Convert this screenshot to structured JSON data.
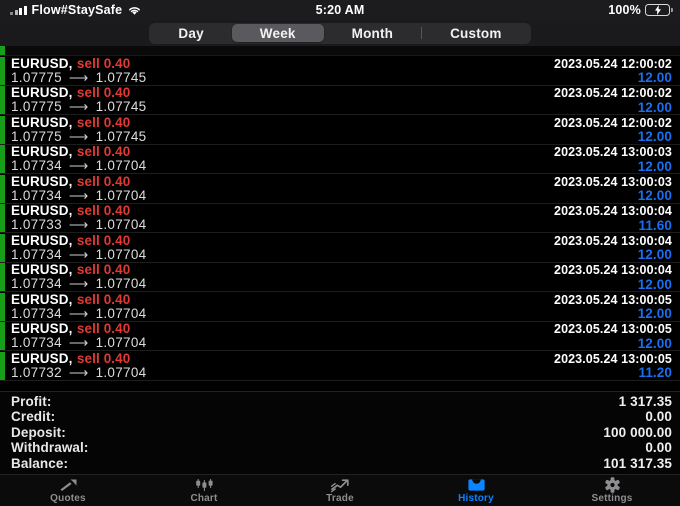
{
  "statusbar": {
    "carrier": "Flow#StaySafe",
    "time": "5:20 AM",
    "battery_percent": "100%",
    "signal_icon": "cellular-signal-icon",
    "wifi_icon": "wifi-icon",
    "battery_icon": "battery-charging-icon"
  },
  "period_filter": {
    "segments": [
      {
        "label": "Day",
        "active": false
      },
      {
        "label": "Week",
        "active": true
      },
      {
        "label": "Month",
        "active": false
      },
      {
        "label": "Custom",
        "active": false
      }
    ]
  },
  "history": {
    "rows": [
      {
        "symbol": "EURUSD,",
        "side": "sell 0.40",
        "time": "2023.05.24 12:00:02",
        "open": "1.07775",
        "close": "1.07745",
        "profit": "12.00"
      },
      {
        "symbol": "EURUSD,",
        "side": "sell 0.40",
        "time": "2023.05.24 12:00:02",
        "open": "1.07775",
        "close": "1.07745",
        "profit": "12.00"
      },
      {
        "symbol": "EURUSD,",
        "side": "sell 0.40",
        "time": "2023.05.24 12:00:02",
        "open": "1.07775",
        "close": "1.07745",
        "profit": "12.00"
      },
      {
        "symbol": "EURUSD,",
        "side": "sell 0.40",
        "time": "2023.05.24 13:00:03",
        "open": "1.07734",
        "close": "1.07704",
        "profit": "12.00"
      },
      {
        "symbol": "EURUSD,",
        "side": "sell 0.40",
        "time": "2023.05.24 13:00:03",
        "open": "1.07734",
        "close": "1.07704",
        "profit": "12.00"
      },
      {
        "symbol": "EURUSD,",
        "side": "sell 0.40",
        "time": "2023.05.24 13:00:04",
        "open": "1.07733",
        "close": "1.07704",
        "profit": "11.60"
      },
      {
        "symbol": "EURUSD,",
        "side": "sell 0.40",
        "time": "2023.05.24 13:00:04",
        "open": "1.07734",
        "close": "1.07704",
        "profit": "12.00"
      },
      {
        "symbol": "EURUSD,",
        "side": "sell 0.40",
        "time": "2023.05.24 13:00:04",
        "open": "1.07734",
        "close": "1.07704",
        "profit": "12.00"
      },
      {
        "symbol": "EURUSD,",
        "side": "sell 0.40",
        "time": "2023.05.24 13:00:05",
        "open": "1.07734",
        "close": "1.07704",
        "profit": "12.00"
      },
      {
        "symbol": "EURUSD,",
        "side": "sell 0.40",
        "time": "2023.05.24 13:00:05",
        "open": "1.07734",
        "close": "1.07704",
        "profit": "12.00"
      },
      {
        "symbol": "EURUSD,",
        "side": "sell 0.40",
        "time": "2023.05.24 13:00:05",
        "open": "1.07732",
        "close": "1.07704",
        "profit": "11.20"
      }
    ],
    "arrow_glyph": "⟶"
  },
  "summary": {
    "items": [
      {
        "label": "Profit:",
        "value": "1 317.35"
      },
      {
        "label": "Credit:",
        "value": "0.00"
      },
      {
        "label": "Deposit:",
        "value": "100 000.00"
      },
      {
        "label": "Withdrawal:",
        "value": "0.00"
      },
      {
        "label": "Balance:",
        "value": "101 317.35"
      }
    ]
  },
  "tabbar": {
    "tabs": [
      {
        "label": "Quotes",
        "icon": "quotes-arrows-icon",
        "active": false
      },
      {
        "label": "Chart",
        "icon": "candlestick-chart-icon",
        "active": false
      },
      {
        "label": "Trade",
        "icon": "trend-arrow-icon",
        "active": false
      },
      {
        "label": "History",
        "icon": "history-tray-icon",
        "active": true
      },
      {
        "label": "Settings",
        "icon": "gear-icon",
        "active": false
      }
    ]
  },
  "colors": {
    "accent": "#0a84ff",
    "sell": "#e03a34",
    "profit": "#1a6ff0",
    "buy_bar": "#17a017",
    "background": "#000000"
  }
}
